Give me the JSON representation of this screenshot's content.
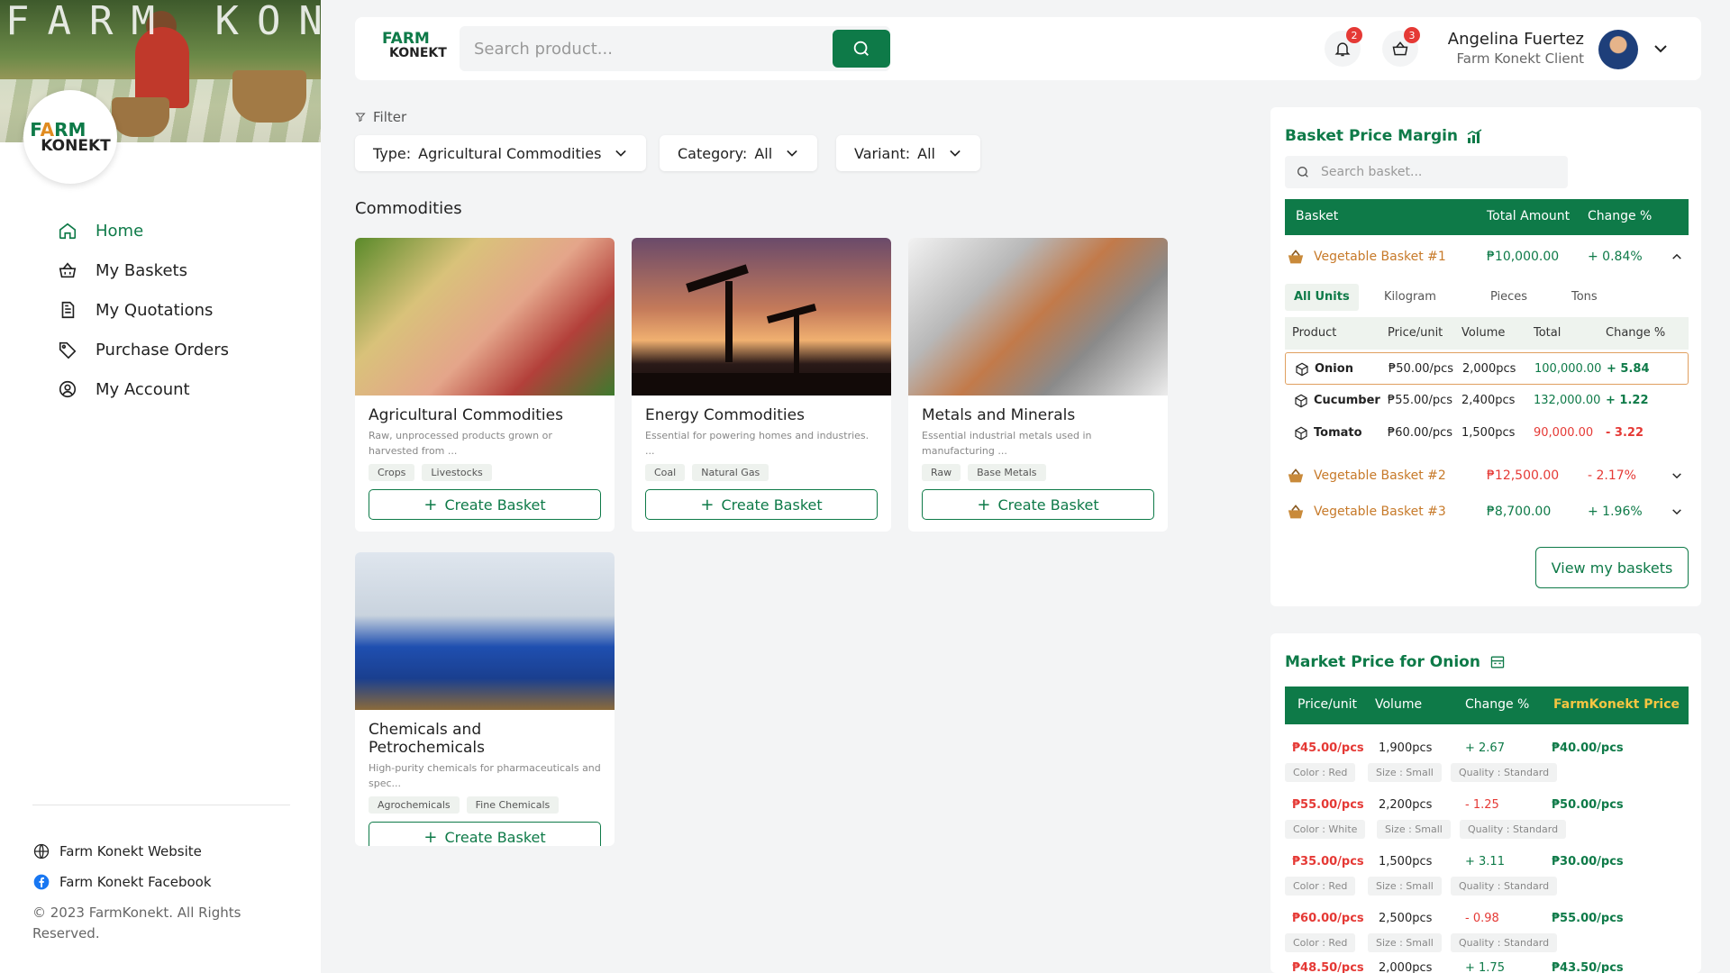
{
  "sidebar": {
    "hero_watermark": "FARM KONEKT",
    "logo": {
      "line1_a": "F",
      "line1_b": "A",
      "line1_c": "RM",
      "line2": "KONEKT"
    },
    "nav": [
      {
        "label": "Home",
        "icon": "home-icon",
        "active": true
      },
      {
        "label": "My Baskets",
        "icon": "basket-icon"
      },
      {
        "label": "My Quotations",
        "icon": "quotation-icon"
      },
      {
        "label": "Purchase Orders",
        "icon": "tag-icon"
      },
      {
        "label": "My Account",
        "icon": "account-icon"
      }
    ],
    "footer": {
      "website": "Farm Konekt Website",
      "facebook": "Farm Konekt Facebook",
      "copyright": "© 2023 FarmKonekt. All Rights Reserved."
    }
  },
  "topbar": {
    "logo": {
      "line1": "FARM",
      "line2": "KONEKT"
    },
    "search_placeholder": "Search product...",
    "notifications_count": "2",
    "cart_count": "3",
    "user_name": "Angelina Fuertez",
    "user_role": "Farm Konekt Client"
  },
  "filters": {
    "label": "Filter",
    "type": {
      "key": "Type:",
      "value": "Agricultural Commodities"
    },
    "category": {
      "key": "Category:",
      "value": "All"
    },
    "variant": {
      "key": "Variant:",
      "value": "All"
    }
  },
  "commodities": {
    "title": "Commodities",
    "cards": [
      {
        "title": "Agricultural Commodities",
        "desc": "Raw, unprocessed products grown or harvested from ...",
        "tags": [
          "Crops",
          "Livestocks"
        ],
        "button": "Create Basket"
      },
      {
        "title": "Energy Commodities",
        "desc": "Essential for powering homes and industries. ...",
        "tags": [
          "Coal",
          "Natural Gas"
        ],
        "button": "Create Basket"
      },
      {
        "title": "Metals and Minerals",
        "desc": "Essential industrial metals used in manufacturing ...",
        "tags": [
          "Raw",
          "Base Metals"
        ],
        "button": "Create Basket"
      },
      {
        "title": "Chemicals and Petrochemicals",
        "desc": "High-purity chemicals for pharmaceuticals and spec...",
        "tags": [
          "Agrochemicals",
          "Fine Chemicals"
        ],
        "button": "Create Basket"
      }
    ]
  },
  "basket_margin": {
    "title": "Basket Price Margin",
    "search_placeholder": "Search basket...",
    "headers": {
      "basket": "Basket",
      "total": "Total Amount",
      "change": "Change %"
    },
    "baskets": [
      {
        "name": "Vegetable Basket #1",
        "total": "₱10,000.00",
        "change": "+ 0.84%",
        "expanded": true
      },
      {
        "name": "Vegetable Basket #2",
        "total": "₱12,500.00",
        "change": "- 2.17%",
        "expanded": false
      },
      {
        "name": "Vegetable Basket #3",
        "total": "₱8,700.00",
        "change": "+ 1.96%",
        "expanded": false
      }
    ],
    "unit_tabs": [
      "All Units",
      "Kilogram",
      "Pieces",
      "Tons"
    ],
    "product_headers": {
      "product": "Product",
      "price": "Price/unit",
      "volume": "Volume",
      "total": "Total",
      "change": "Change %"
    },
    "products": [
      {
        "name": "Onion",
        "price": "₱50.00/pcs",
        "volume": "2,000pcs",
        "total": "100,000.00",
        "change": "+ 5.84"
      },
      {
        "name": "Cucumber",
        "price": "₱55.00/pcs",
        "volume": "2,400pcs",
        "total": "132,000.00",
        "change": "+ 1.22"
      },
      {
        "name": "Tomato",
        "price": "₱60.00/pcs",
        "volume": "1,500pcs",
        "total": "90,000.00",
        "change": "- 3.22"
      }
    ],
    "view_button": "View my baskets"
  },
  "market_price": {
    "title": "Market Price for Onion",
    "headers": {
      "price": "Price/unit",
      "volume": "Volume",
      "change": "Change %",
      "fk": "FarmKonekt Price"
    },
    "rows": [
      {
        "price": "₱45.00/pcs",
        "volume": "1,900pcs",
        "change": "+ 2.67",
        "fk": "₱40.00/pcs",
        "color": "Color : Red",
        "size": "Size : Small",
        "quality": "Quality : Standard"
      },
      {
        "price": "₱55.00/pcs",
        "volume": "2,200pcs",
        "change": "- 1.25",
        "fk": "₱50.00/pcs",
        "color": "Color : White",
        "size": "Size : Small",
        "quality": "Quality : Standard"
      },
      {
        "price": "₱35.00/pcs",
        "volume": "1,500pcs",
        "change": "+ 3.11",
        "fk": "₱30.00/pcs",
        "color": "Color : Red",
        "size": "Size : Small",
        "quality": "Quality : Standard"
      },
      {
        "price": "₱60.00/pcs",
        "volume": "2,500pcs",
        "change": "- 0.98",
        "fk": "₱55.00/pcs",
        "color": "Color : Red",
        "size": "Size : Small",
        "quality": "Quality : Standard"
      },
      {
        "price": "₱48.50/pcs",
        "volume": "2,000pcs",
        "change": "+ 1.75",
        "fk": "₱43.50/pcs",
        "color": "",
        "size": "",
        "quality": ""
      }
    ]
  },
  "colors": {
    "brand_green": "#0e7a48",
    "accent_orange": "#c77a2a",
    "negative_red": "#e53935",
    "fk_yellow": "#f5c542"
  }
}
